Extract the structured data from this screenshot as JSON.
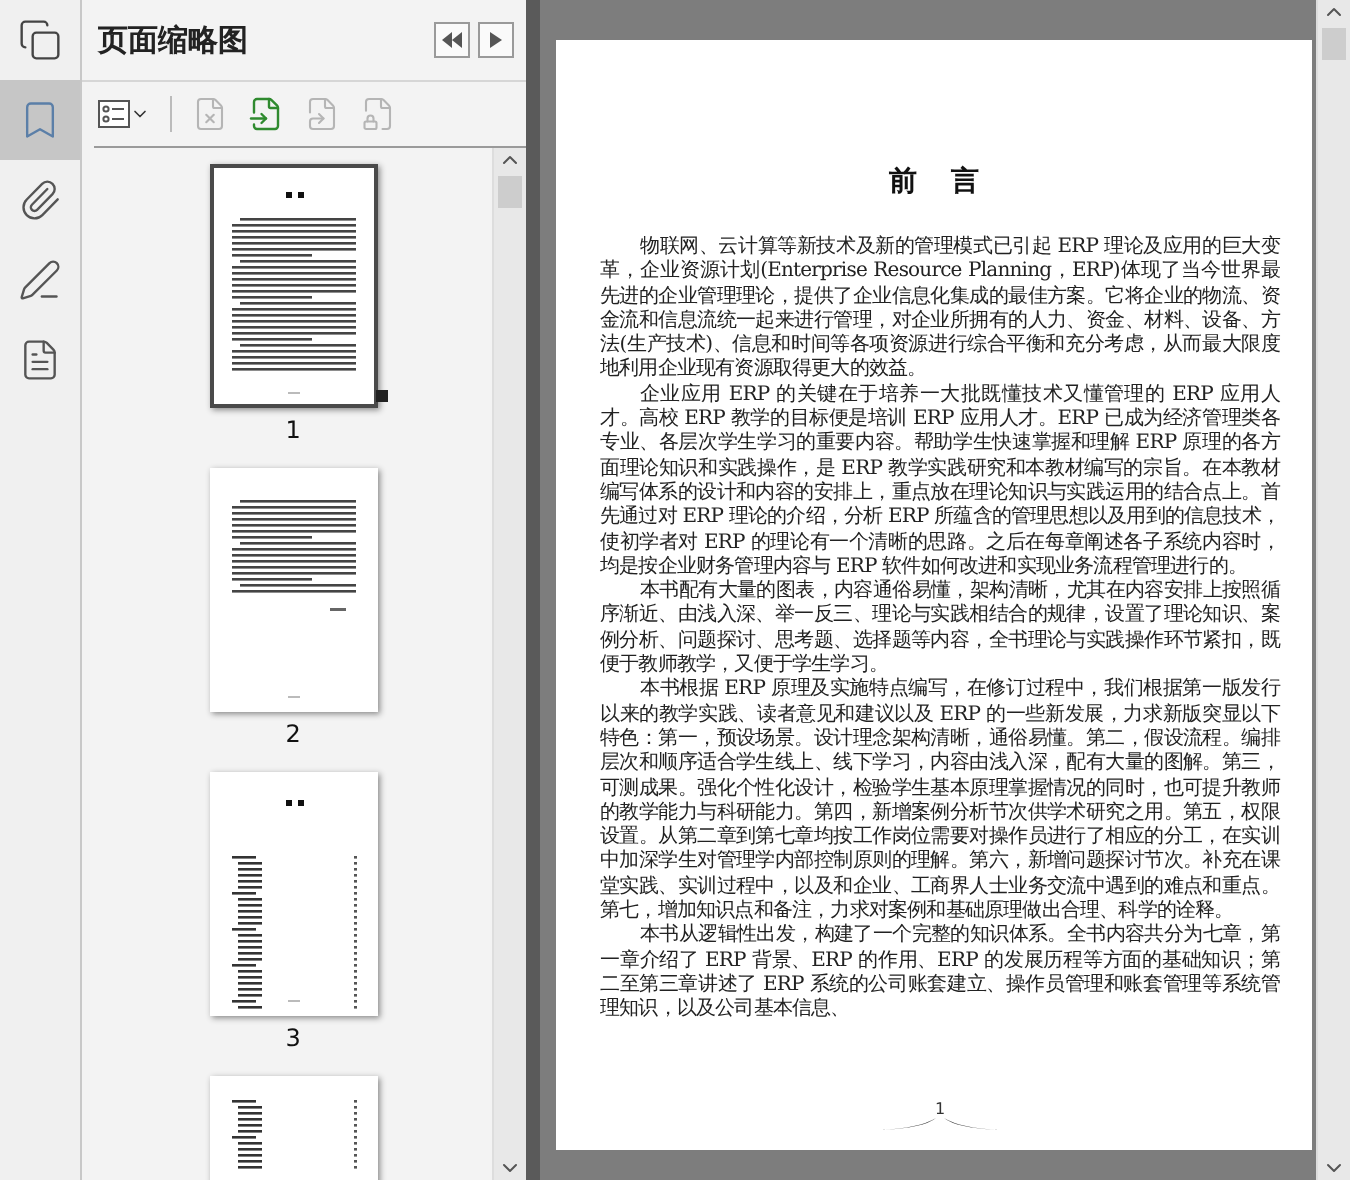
{
  "panel": {
    "title": "页面缩略图"
  },
  "thumbnails": [
    {
      "label": "1",
      "kind": "text",
      "selected": true
    },
    {
      "label": "2",
      "kind": "text_short",
      "selected": false
    },
    {
      "label": "3",
      "kind": "toc",
      "selected": false
    },
    {
      "kind": "toc_top",
      "selected": false
    }
  ],
  "document": {
    "heading": "前 言",
    "paragraphs": [
      "物联网、云计算等新技术及新的管理模式已引起 ERP 理论及应用的巨大变革，企业资源计划(Enterprise Resource Planning，ERP)体现了当今世界最先进的企业管理理论，提供了企业信息化集成的最佳方案。它将企业的物流、资金流和信息流统一起来进行管理，对企业所拥有的人力、资金、材料、设备、方法(生产技术)、信息和时间等各项资源进行综合平衡和充分考虑，从而最大限度地利用企业现有资源取得更大的效益。",
      "企业应用 ERP 的关键在于培养一大批既懂技术又懂管理的 ERP 应用人才。高校 ERP 教学的目标便是培训 ERP 应用人才。ERP 已成为经济管理类各专业、各层次学生学习的重要内容。帮助学生快速掌握和理解 ERP 原理的各方面理论知识和实践操作，是 ERP 教学实践研究和本教材编写的宗旨。在本教材编写体系的设计和内容的安排上，重点放在理论知识与实践运用的结合点上。首先通过对 ERP 理论的介绍，分析 ERP 所蕴含的管理思想以及用到的信息技术，使初学者对 ERP 的理论有一个清晰的思路。之后在每章阐述各子系统内容时，均是按企业财务管理内容与 ERP 软件如何改进和实现业务流程管理进行的。",
      "本书配有大量的图表，内容通俗易懂，架构清晰，尤其在内容安排上按照循序渐近、由浅入深、举一反三、理论与实践相结合的规律，设置了理论知识、案例分析、问题探讨、思考题、选择题等内容，全书理论与实践操作环节紧扣，既便于教师教学，又便于学生学习。",
      "本书根据 ERP 原理及实施特点编写，在修订过程中，我们根据第一版发行以来的教学实践、读者意见和建议以及 ERP 的一些新发展，力求新版突显以下特色：第一，预设场景。设计理念架构清晰，通俗易懂。第二，假设流程。编排层次和顺序适合学生线上、线下学习，内容由浅入深，配有大量的图解。第三，可测成果。强化个性化设计，检验学生基本原理掌握情况的同时，也可提升教师的教学能力与科研能力。第四，新增案例分析节次供学术研究之用。第五，权限设置。从第二章到第七章均按工作岗位需要对操作员进行了相应的分工，在实训中加深学生对管理学内部控制原则的理解。第六，新增问题探讨节次。补充在课堂实践、实训过程中，以及和企业、工商界人士业务交流中遇到的难点和重点。第七，增加知识点和备注，力求对案例和基础原理做出合理、科学的诠释。",
      "本书从逻辑性出发，构建了一个完整的知识体系。全书内容共分为七章，第一章介绍了 ERP 背景、ERP 的作用、ERP 的发展历程等方面的基础知识；第二至第三章讲述了 ERP 系统的公司账套建立、操作员管理和账套管理等系统管理知识，以及公司基本信息、"
    ],
    "page_number": "1"
  }
}
